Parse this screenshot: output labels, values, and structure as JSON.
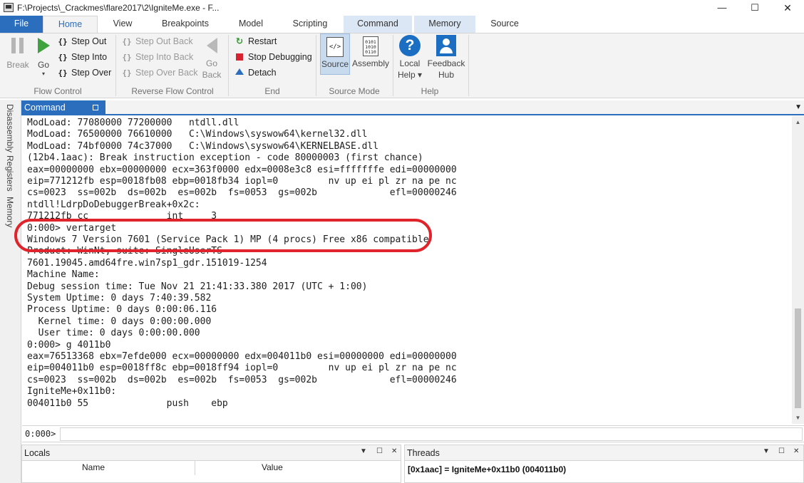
{
  "window": {
    "title": "F:\\Projects\\_Crackmes\\flare2017\\2\\IgniteMe.exe - F...",
    "minimize": "—",
    "maximize": "☐",
    "close": "✕"
  },
  "tabs": {
    "file": "File",
    "home": "Home",
    "view": "View",
    "breakpoints": "Breakpoints",
    "model": "Model",
    "scripting": "Scripting",
    "command": "Command",
    "memory": "Memory",
    "source": "Source"
  },
  "ribbon": {
    "flow_control": {
      "label": "Flow Control",
      "break": "Break",
      "go": "Go",
      "step_out": "Step Out",
      "step_into": "Step Into",
      "step_over": "Step Over"
    },
    "reverse_flow": {
      "label": "Reverse Flow Control",
      "step_out_back": "Step Out Back",
      "step_into_back": "Step Into Back",
      "step_over_back": "Step Over Back",
      "go_back_1": "Go",
      "go_back_2": "Back"
    },
    "end": {
      "label": "End",
      "restart": "Restart",
      "stop": "Stop Debugging",
      "detach": "Detach"
    },
    "source_mode": {
      "label": "Source Mode",
      "source": "Source",
      "assembly": "Assembly",
      "source_glyph": "</>",
      "assembly_glyph": "0101 1010 0110"
    },
    "help": {
      "label": "Help",
      "local_help_1": "Local",
      "local_help_2": "Help ▾",
      "feedback_1": "Feedback",
      "feedback_2": "Hub",
      "help_glyph": "?"
    }
  },
  "side_tabs": {
    "disassembly": "Disassembly",
    "registers": "Registers",
    "memory": "Memory"
  },
  "command_window": {
    "title": "Command",
    "menu_glyph": "▼",
    "lines": [
      "ModLoad: 77080000 77200000   ntdll.dll",
      "ModLoad: 76500000 76610000   C:\\Windows\\syswow64\\kernel32.dll",
      "ModLoad: 74bf0000 74c37000   C:\\Windows\\syswow64\\KERNELBASE.dll",
      "(12b4.1aac): Break instruction exception - code 80000003 (first chance)",
      "eax=00000000 ebx=00000000 ecx=363f0000 edx=0008e3c8 esi=fffffffe edi=00000000",
      "eip=771212fb esp=0018fb08 ebp=0018fb34 iopl=0         nv up ei pl zr na pe nc",
      "cs=0023  ss=002b  ds=002b  es=002b  fs=0053  gs=002b             efl=00000246",
      "ntdll!LdrpDoDebuggerBreak+0x2c:",
      "771212fb cc              int     3",
      "0:000> vertarget",
      "Windows 7 Version 7601 (Service Pack 1) MP (4 procs) Free x86 compatible",
      "Product: WinNt, suite: SingleUserTS",
      "7601.19045.amd64fre.win7sp1_gdr.151019-1254",
      "Machine Name:",
      "Debug session time: Tue Nov 21 21:41:33.380 2017 (UTC + 1:00)",
      "System Uptime: 0 days 7:40:39.582",
      "Process Uptime: 0 days 0:00:06.116",
      "  Kernel time: 0 days 0:00:00.000",
      "  User time: 0 days 0:00:00.000",
      "0:000> g 4011b0",
      "eax=76513368 ebx=7efde000 ecx=00000000 edx=004011b0 esi=00000000 edi=00000000",
      "eip=004011b0 esp=0018ff8c ebp=0018ff94 iopl=0         nv up ei pl zr na pe nc",
      "cs=0023  ss=002b  ds=002b  es=002b  fs=0053  gs=002b             efl=00000246",
      "IgniteMe+0x11b0:",
      "004011b0 55              push    ebp"
    ],
    "prompt": "0:000>",
    "input_value": "",
    "scroll_up": "▲",
    "scroll_down": "▼"
  },
  "locals": {
    "title": "Locals",
    "col_name": "Name",
    "col_value": "Value"
  },
  "threads": {
    "title": "Threads",
    "current": "[0x1aac] = IgniteMe+0x11b0 (004011b0)"
  },
  "pane_controls": {
    "menu": "▼",
    "pin": "☐",
    "close": "✕"
  }
}
